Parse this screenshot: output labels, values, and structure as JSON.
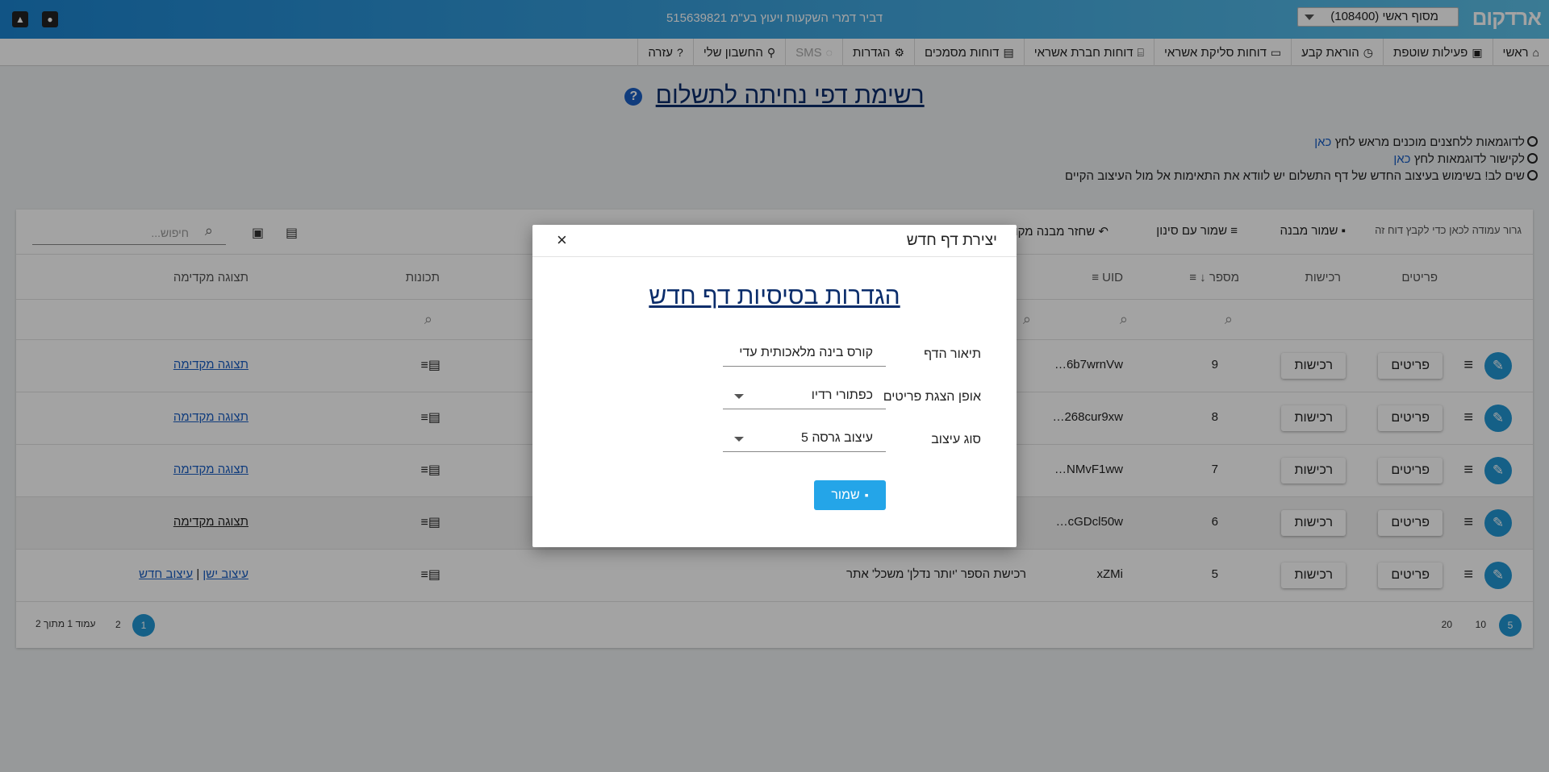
{
  "topbar": {
    "logo": "ארדקום",
    "terminal_select": "מסוף ראשי (108400)",
    "company": "דביר דמרי השקעות ויעוץ בע\"מ 515639821"
  },
  "nav": {
    "items": [
      {
        "icon": "⌂",
        "label": "ראשי"
      },
      {
        "icon": "▣",
        "label": "פעילות שוטפת"
      },
      {
        "icon": "◷",
        "label": "הוראת קבע"
      },
      {
        "icon": "▭",
        "label": "דוחות סליקת אשראי"
      },
      {
        "icon": "⌸",
        "label": "דוחות חברת אשראי"
      },
      {
        "icon": "▤",
        "label": "דוחות מסמכים"
      },
      {
        "icon": "⚙",
        "label": "הגדרות"
      },
      {
        "icon": "◌",
        "label": "SMS"
      },
      {
        "icon": "⚲",
        "label": "החשבון שלי"
      },
      {
        "icon": "?",
        "label": "עזרה"
      }
    ]
  },
  "page": {
    "title": "רשימת דפי נחיתה לתשלום",
    "note1": "לדוגמאות ללחצנים מוכנים מראש לחץ",
    "note1_link": "כאן",
    "note2": "לקישור לדוגמאות לחץ",
    "note2_link": "כאן",
    "note3": "שים לב! בשימוש בעיצוב החדש של דף התשלום יש לוודא את התאימות אל מול העיצוב הקיים"
  },
  "toolbar": {
    "drag_hint": "גרור עמודה לכאן כדי לקבץ דוח זה",
    "save_structure": "שמור מבנה",
    "save_filter": "שמור עם סינון",
    "restore": "שחזר מבנה מקורי",
    "search_placeholder": "חיפוש..."
  },
  "table": {
    "headers": {
      "details": "פריטים",
      "purchases": "רכישות",
      "number": "מספר",
      "uid": "UID",
      "features": "תכונות",
      "preview": "תצוגה מקדימה"
    },
    "details_btn": "פריטים",
    "purchases_btn": "רכישות",
    "rows": [
      {
        "number": "9",
        "uid": "6b7wrnVw…",
        "preview": "תצוגה מקדימה"
      },
      {
        "number": "8",
        "uid": "268cur9xw…",
        "preview": "תצוגה מקדימה"
      },
      {
        "number": "7",
        "uid": "NMvF1ww…",
        "preview": "תצוגה מקדימה"
      },
      {
        "number": "6",
        "uid": "cGDcl50w…",
        "preview": "תצוגה מקדימה"
      },
      {
        "number": "5",
        "uid": "xZMi",
        "desc": "רכישת הספר 'יותר נדלן' משכל' אתר",
        "old_design": "עיצוב ישן",
        "sep": "|",
        "new_design": "עיצוב חדש"
      }
    ]
  },
  "pagination": {
    "sizes": [
      "5",
      "10",
      "20"
    ],
    "pages": [
      "1",
      "2"
    ],
    "summary": "עמוד 1 מתוך 2"
  },
  "modal": {
    "title": "יצירת דף חדש",
    "heading": "הגדרות בסיסיות דף חדש",
    "fields": [
      {
        "label": "תיאור הדף",
        "value": "קורס בינה מלאכותית עדי"
      },
      {
        "label": "אופן הצגת פריטים",
        "value": "כפתורי רדיו"
      },
      {
        "label": "סוג עיצוב",
        "value": "עיצוב גרסה 5"
      }
    ],
    "save": "שמור",
    "close": "×"
  }
}
